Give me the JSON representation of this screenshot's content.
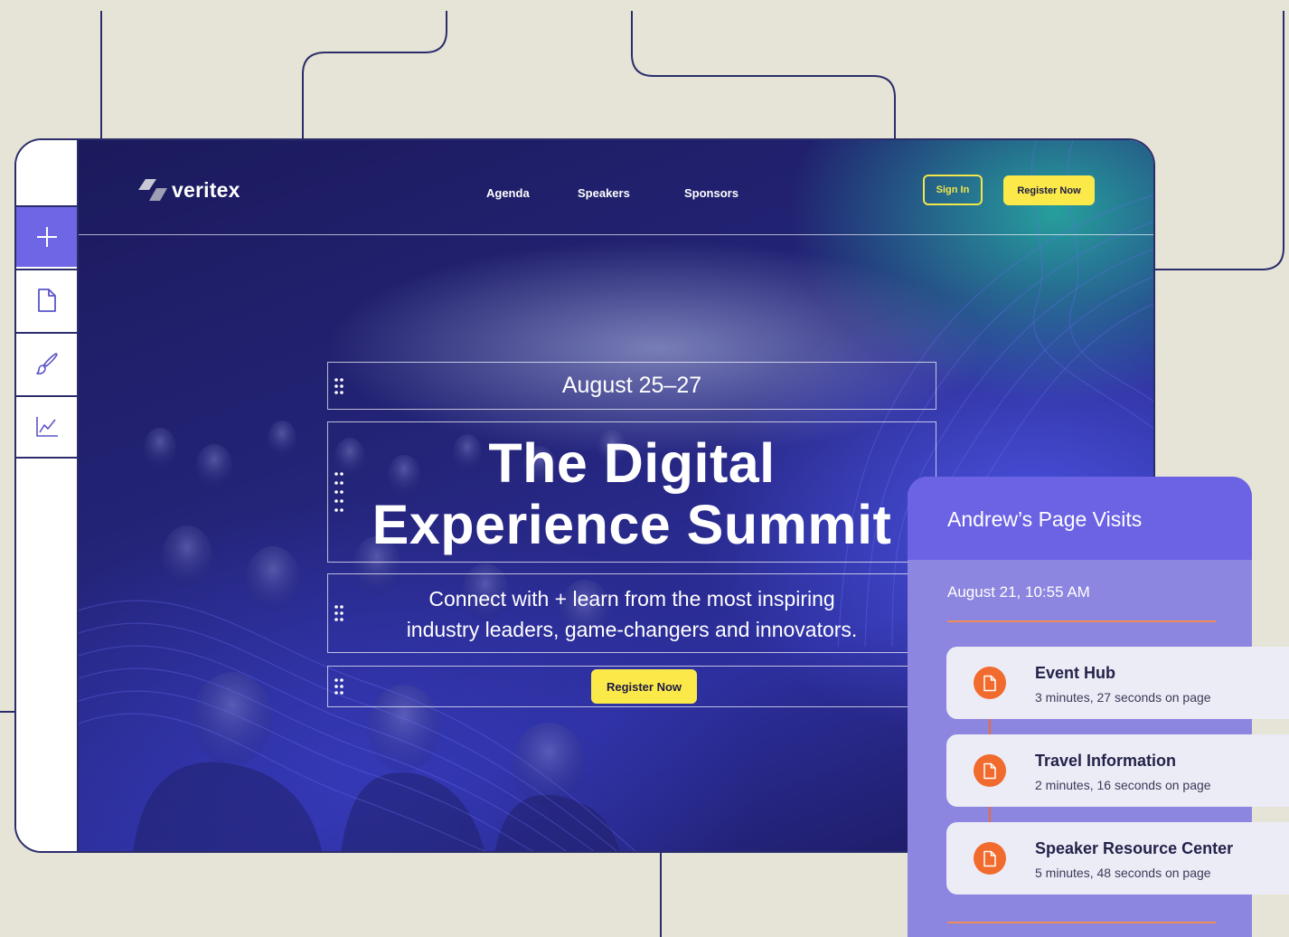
{
  "brand": {
    "name": "veritex"
  },
  "nav": {
    "links": [
      "Agenda",
      "Speakers",
      "Sponsors"
    ],
    "sign_in": "Sign In",
    "register": "Register Now"
  },
  "toolbar": {
    "tools": [
      "plus-icon",
      "page-icon",
      "brush-icon",
      "chart-line-icon"
    ],
    "active": "plus-icon"
  },
  "hero": {
    "date": "August 25–27",
    "title_line1": "The Digital",
    "title_line2": "Experience Summit",
    "subtitle_line1": "Connect with + learn from the most inspiring",
    "subtitle_line2": "industry leaders, game-changers and innovators.",
    "cta": "Register Now"
  },
  "visits_panel": {
    "title": "Andrew’s Page Visits",
    "timestamp": "August 21, 10:55 AM",
    "visits": [
      {
        "page": "Event Hub",
        "duration": "3 minutes, 27 seconds on page"
      },
      {
        "page": "Travel Information",
        "duration": "2 minutes, 16 seconds on page"
      },
      {
        "page": "Speaker Resource Center",
        "duration": "5 minutes, 48 seconds on page"
      }
    ]
  },
  "colors": {
    "background": "#e6e4d6",
    "accent_purple": "#6f66e6",
    "cta_yellow": "#fbe94a",
    "icon_orange": "#f06b2d",
    "line_navy": "#2b2d6b"
  }
}
